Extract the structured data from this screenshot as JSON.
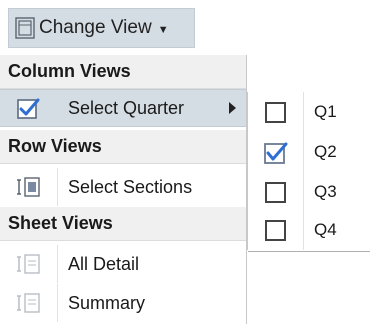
{
  "toolbar": {
    "change_view_label": "Change View",
    "icon": "view-icon"
  },
  "menu": {
    "column_views": {
      "header": "Column Views",
      "items": [
        {
          "label": "Select Quarter",
          "icon": "checkbox-checked-icon",
          "has_submenu": true,
          "highlighted": true
        }
      ]
    },
    "row_views": {
      "header": "Row Views",
      "items": [
        {
          "label": "Select Sections",
          "icon": "sections-icon"
        }
      ]
    },
    "sheet_views": {
      "header": "Sheet Views",
      "items": [
        {
          "label": "All Detail",
          "icon": "sheet-icon"
        },
        {
          "label": "Summary",
          "icon": "sheet-icon"
        }
      ]
    }
  },
  "quarter_submenu": {
    "items": [
      {
        "label": "Q1",
        "checked": false
      },
      {
        "label": "Q2",
        "checked": true
      },
      {
        "label": "Q3",
        "checked": false
      },
      {
        "label": "Q4",
        "checked": false
      }
    ]
  },
  "colors": {
    "highlight": "#d5dde4",
    "check_accent": "#2e6fd1",
    "header_bg": "#f0f0f0"
  }
}
